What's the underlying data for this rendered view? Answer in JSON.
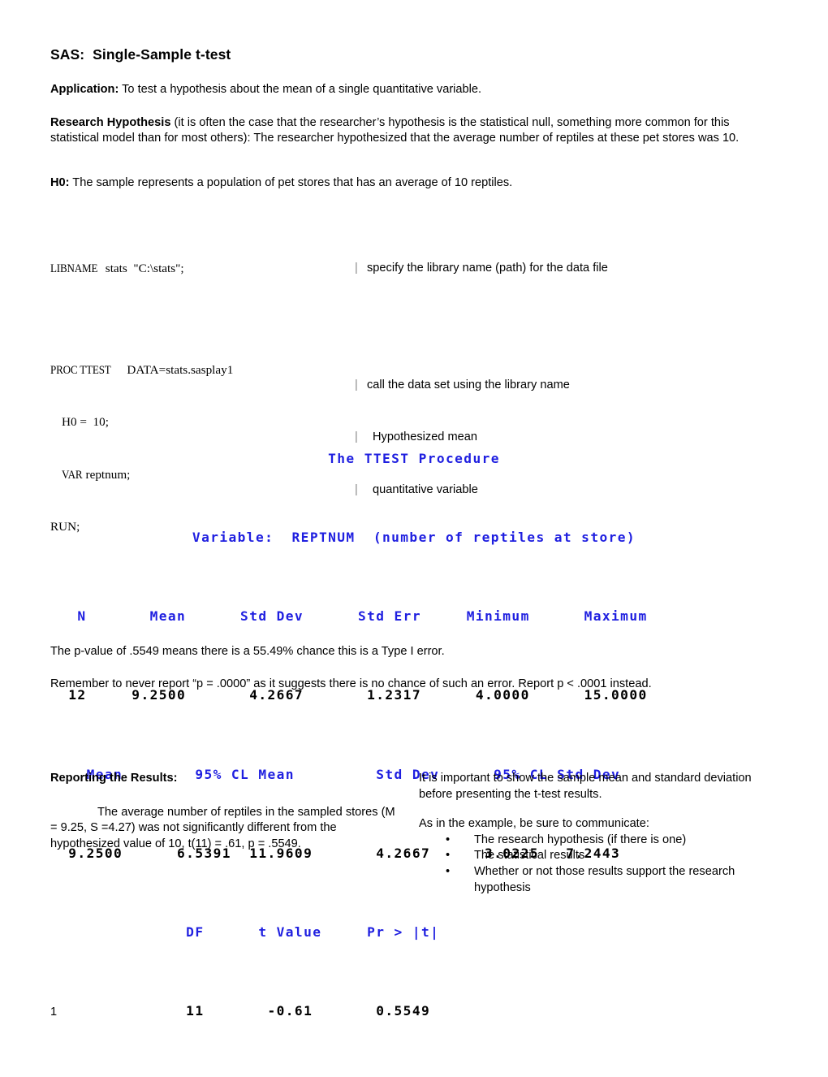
{
  "document": {
    "title": "SAS:  Single-Sample t-test",
    "page_number": "1"
  },
  "sections": {
    "application": {
      "label": "Application:",
      "text": " To test a hypothesis about the mean of a single quantitative variable."
    },
    "research_hypothesis": {
      "label": "Research Hypothesis",
      "text": " (it is often the case that the researcher’s hypothesis is the statistical null, something more common for this statistical model than for most  others): The researcher hypothesized that the average number of reptiles at these pet stores was 10."
    },
    "null_hypothesis": {
      "label": "H0:",
      "text": " The sample represents a population of pet stores that has an average of 10 reptiles."
    }
  },
  "code": {
    "lines": [
      {
        "keyword": "LIBNAME",
        "rest": "stats  \"C:\\stats\";",
        "indent": false
      },
      {
        "keyword": "",
        "rest": "",
        "indent": false
      },
      {
        "keyword": "PROC TTEST",
        "rest": "  DATA=stats.sasplay1",
        "indent": false
      },
      {
        "keyword": "",
        "rest": "H0 =  10;",
        "indent": true
      },
      {
        "keyword": "VAR",
        "rest": "reptnum;",
        "indent": true
      },
      {
        "keyword": "",
        "rest": "RUN;",
        "indent": false
      }
    ],
    "line1": "LIBNAME",
    "line1_rest": "stats  \"C:\\stats\";",
    "line2_kw": "PROC TTEST",
    "line2_rest": "  DATA=stats.sasplay1",
    "line3": "H0 =  10;",
    "line4_kw": "VAR",
    "line4_rest": "reptnum;",
    "line5": "RUN;"
  },
  "annotations": {
    "libname": "specify the library name (path) for the data file",
    "proc": "call the data set using the library name",
    "h0": "Hypothesized mean",
    "var": "quantitative variable",
    "pipe": "|"
  },
  "sas_output": {
    "procedure_title": "The TTEST Procedure",
    "variable_line": "Variable:  REPTNUM  (number of reptiles at store)",
    "table1": {
      "headers": [
        "N",
        "Mean",
        "Std Dev",
        "Std Err",
        "Minimum",
        "Maximum"
      ],
      "row": [
        "12",
        "9.2500",
        "4.2667",
        "1.2317",
        "4.0000",
        "15.0000"
      ],
      "header_line": "   N       Mean      Std Dev      Std Err     Minimum      Maximum",
      "value_line": "  12     9.2500       4.2667       1.2317      4.0000      15.0000"
    },
    "table2": {
      "headers": [
        "Mean",
        "95% CL Mean",
        "Std Dev",
        "95% CL Std Dev"
      ],
      "row": [
        "9.2500",
        "6.5391",
        "11.9609",
        "4.2667",
        "3.0225",
        "7.2443"
      ],
      "header_line": "    Mean        95% CL Mean         Std Dev      95% CL Std Dev",
      "value_line": "  9.2500      6.5391  11.9609       4.2667      3.0225   7.2443"
    },
    "table3": {
      "headers": [
        "DF",
        "t Value",
        "Pr > |t|"
      ],
      "row": [
        "11",
        "-0.61",
        "0.5549"
      ],
      "header_line": "               DF      t Value     Pr > |t|",
      "value_line": "               11       -0.61       0.5549"
    },
    "color_header": "#1f1fe0",
    "color_value": "#000000"
  },
  "notes": {
    "pvalue": "The p-value of .5549 means there is a 55.49% chance this is a Type I error.",
    "report": "Remember to never report “p = .0000” as it suggests there is no chance of such an error.  Report p < .0001 instead."
  },
  "reporting": {
    "heading": "Reporting the Results:",
    "example": "The average number of reptiles in the sampled stores (M = 9.25, S =4.27) was not significantly different from the hypothesized value of 10, t(11) = .61, p = .5549.",
    "guidance_1": "It is important to show the sample mean and standard deviation  before presenting the t-test results.",
    "guidance_2": "As in the example, be sure to communicate:",
    "bullets": [
      "The research hypothesis (if there is one)",
      "The statistical results",
      "Whether or not those results support the research hypothesis"
    ],
    "bullet_glyph": "•"
  }
}
